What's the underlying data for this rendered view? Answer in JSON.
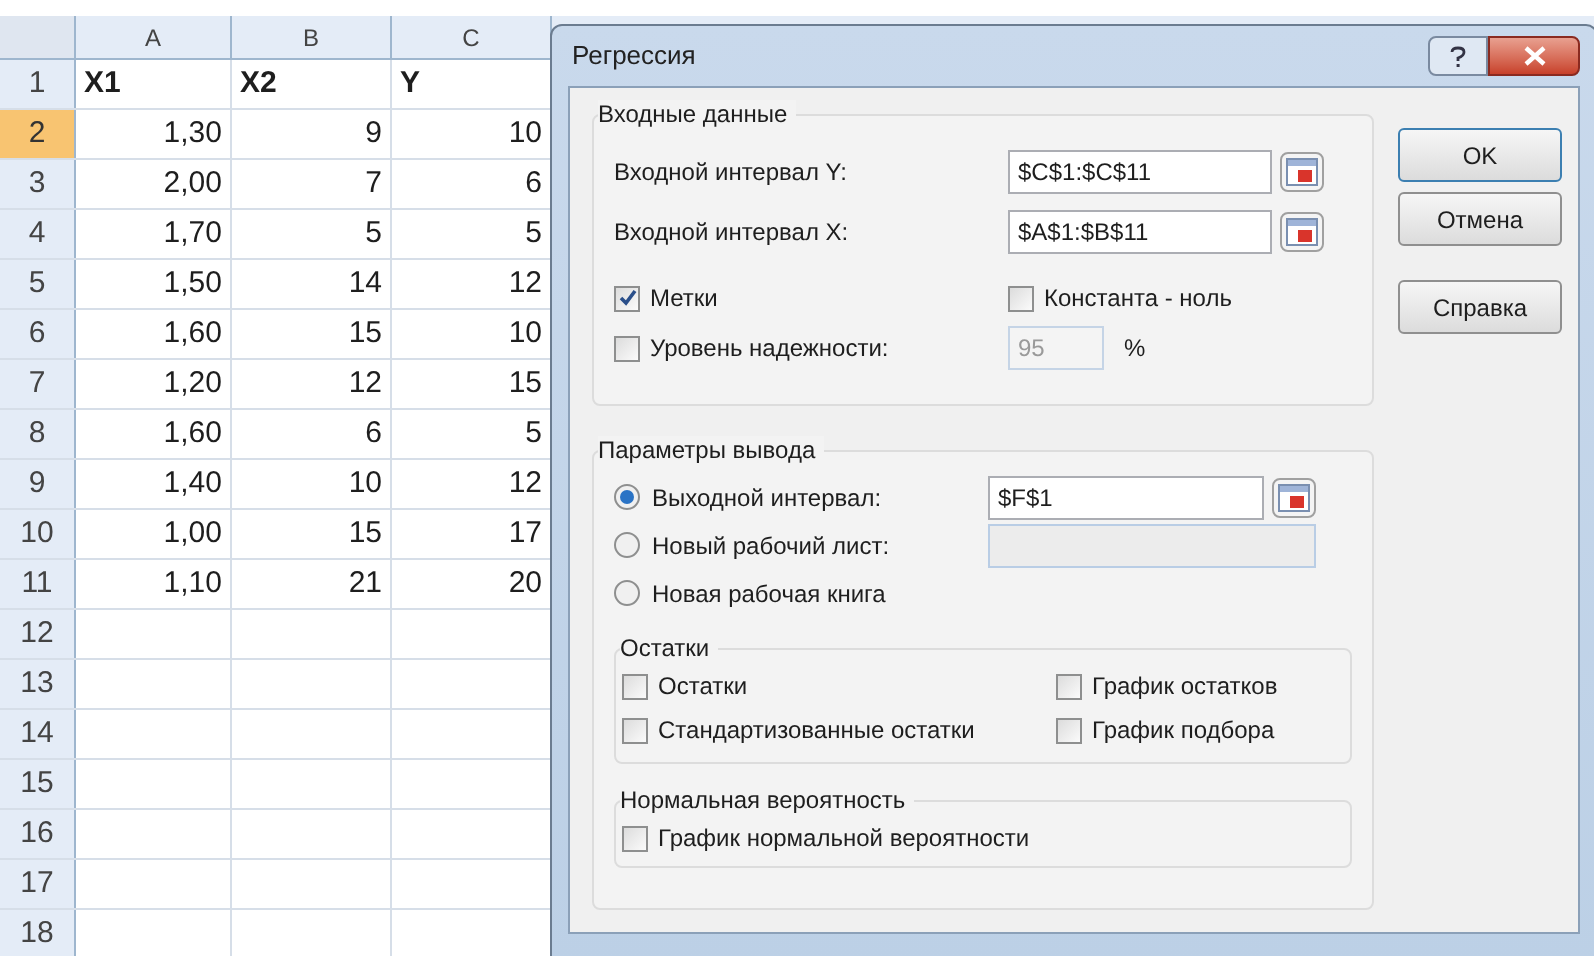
{
  "sheet": {
    "columns": [
      "A",
      "B",
      "C"
    ],
    "rows": [
      {
        "header": "1",
        "selected": false,
        "kind": "labels",
        "cells": [
          "X1",
          "X2",
          "Y"
        ]
      },
      {
        "header": "2",
        "selected": true,
        "kind": "data",
        "cells": [
          "1,30",
          "9",
          "10"
        ]
      },
      {
        "header": "3",
        "selected": false,
        "kind": "data",
        "cells": [
          "2,00",
          "7",
          "6"
        ]
      },
      {
        "header": "4",
        "selected": false,
        "kind": "data",
        "cells": [
          "1,70",
          "5",
          "5"
        ]
      },
      {
        "header": "5",
        "selected": false,
        "kind": "data",
        "cells": [
          "1,50",
          "14",
          "12"
        ]
      },
      {
        "header": "6",
        "selected": false,
        "kind": "data",
        "cells": [
          "1,60",
          "15",
          "10"
        ]
      },
      {
        "header": "7",
        "selected": false,
        "kind": "data",
        "cells": [
          "1,20",
          "12",
          "15"
        ]
      },
      {
        "header": "8",
        "selected": false,
        "kind": "data",
        "cells": [
          "1,60",
          "6",
          "5"
        ]
      },
      {
        "header": "9",
        "selected": false,
        "kind": "data",
        "cells": [
          "1,40",
          "10",
          "12"
        ]
      },
      {
        "header": "10",
        "selected": false,
        "kind": "data",
        "cells": [
          "1,00",
          "15",
          "17"
        ]
      },
      {
        "header": "11",
        "selected": false,
        "kind": "data",
        "cells": [
          "1,10",
          "21",
          "20"
        ]
      },
      {
        "header": "12",
        "selected": false,
        "kind": "empty"
      },
      {
        "header": "13",
        "selected": false,
        "kind": "empty"
      },
      {
        "header": "14",
        "selected": false,
        "kind": "empty"
      },
      {
        "header": "15",
        "selected": false,
        "kind": "empty"
      },
      {
        "header": "16",
        "selected": false,
        "kind": "empty"
      },
      {
        "header": "17",
        "selected": false,
        "kind": "empty"
      },
      {
        "header": "18",
        "selected": false,
        "kind": "empty"
      }
    ]
  },
  "dialog": {
    "title": "Регрессия",
    "input": {
      "title": "Входные данные",
      "fields": [
        {
          "label": "Входной интервал Y:",
          "value": "$C$1:$C$11"
        },
        {
          "label": "Входной интервал X:",
          "value": "$A$1:$B$11"
        }
      ],
      "options": [
        {
          "label": "Метки",
          "checked": true
        },
        {
          "label": "Константа - ноль",
          "checked": false
        },
        {
          "label": "Уровень надежности:",
          "checked": false,
          "value": "95",
          "unit": "%"
        }
      ]
    },
    "output": {
      "title": "Параметры вывода",
      "choices": [
        {
          "label": "Выходной интервал:",
          "selected": true,
          "value": "$F$1"
        },
        {
          "label": "Новый рабочий лист:",
          "selected": false,
          "field": true
        },
        {
          "label": "Новая рабочая книга",
          "selected": false
        }
      ],
      "residuals": {
        "title": "Остатки",
        "options": [
          {
            "label": "Остатки",
            "checked": false
          },
          {
            "label": "График остатков",
            "checked": false
          },
          {
            "label": "Стандартизованные остатки",
            "checked": false
          },
          {
            "label": "График подбора",
            "checked": false
          }
        ]
      },
      "normal": {
        "title": "Нормальная вероятность",
        "options": [
          {
            "label": "График нормальной вероятности",
            "checked": false
          }
        ]
      }
    },
    "buttons": [
      "OK",
      "Отмена",
      "Справка"
    ]
  }
}
